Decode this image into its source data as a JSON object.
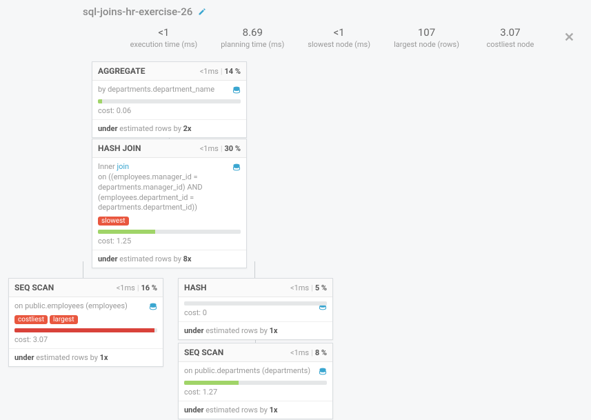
{
  "title": "sql-joins-hr-exercise-26",
  "stats": {
    "exec": {
      "value": "<1",
      "label": "execution time (ms)"
    },
    "plan": {
      "value": "8.69",
      "label": "planning time (ms)"
    },
    "slow": {
      "value": "<1",
      "label": "slowest node (ms)"
    },
    "large": {
      "value": "107",
      "label": "largest node (rows)"
    },
    "cost": {
      "value": "3.07",
      "label": "costliest node"
    }
  },
  "nodes": {
    "agg": {
      "name": "AGGREGATE",
      "time": "<1ms",
      "pct": "14 %",
      "detail_pre": "by ",
      "detail_b": "departments.department_name",
      "bar_pct": "3%",
      "bar_color": "green",
      "cost": "cost: 0.06",
      "est_pre": "under",
      "est_mid": " estimated rows by ",
      "est_b": "2x"
    },
    "hash_join": {
      "name": "HASH JOIN",
      "time": "<1ms",
      "pct": "30 %",
      "detail_pre": "Inner ",
      "detail_join": "join",
      "detail_on": "on ((employees.manager_id = departments.manager_id) AND (employees.department_id = departments.department_id))",
      "badges": [
        "slowest"
      ],
      "bar_pct": "40%",
      "bar_color": "green",
      "cost": "cost: 1.25",
      "est_pre": "under",
      "est_mid": " estimated rows by ",
      "est_b": "8x"
    },
    "seq_emp": {
      "name": "SEQ SCAN",
      "time": "<1ms",
      "pct": "16 %",
      "detail_pre": "on ",
      "detail_b": "public.employees (employees)",
      "badges": [
        "costliest",
        "largest"
      ],
      "bar_pct": "98%",
      "bar_color": "red",
      "cost": "cost: 3.07",
      "est_pre": "under",
      "est_mid": " estimated rows by ",
      "est_b": "1x"
    },
    "hash": {
      "name": "HASH",
      "time": "<1ms",
      "pct": "5 %",
      "bar_pct": "0%",
      "bar_color": "green",
      "cost": "cost: 0",
      "est_pre": "under",
      "est_mid": " estimated rows by ",
      "est_b": "1x"
    },
    "seq_dep": {
      "name": "SEQ SCAN",
      "time": "<1ms",
      "pct": "8 %",
      "detail_pre": "on ",
      "detail_b": "public.departments (departments)",
      "bar_pct": "38%",
      "bar_color": "green",
      "cost": "cost: 1.27",
      "est_pre": "under",
      "est_mid": " estimated rows by ",
      "est_b": "1x"
    }
  }
}
